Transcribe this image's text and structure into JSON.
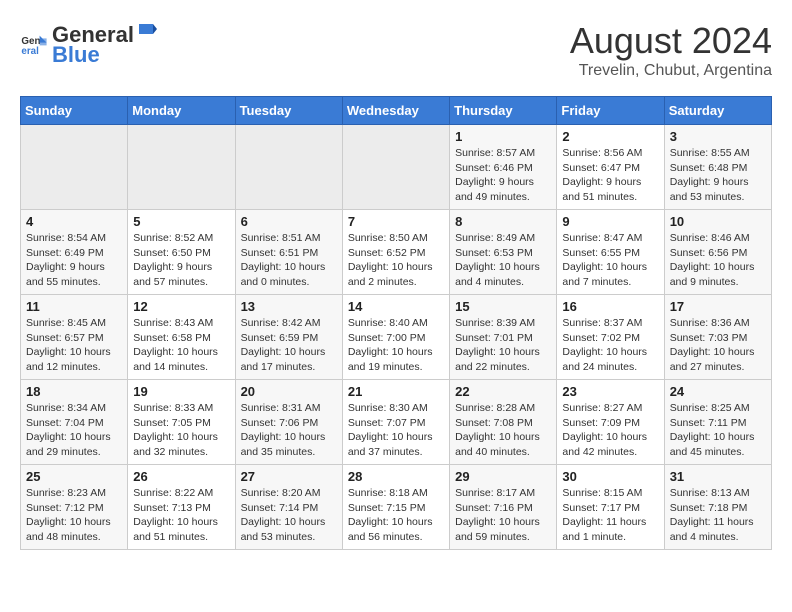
{
  "header": {
    "logo_general": "General",
    "logo_blue": "Blue",
    "month_year": "August 2024",
    "location": "Trevelin, Chubut, Argentina"
  },
  "days_of_week": [
    "Sunday",
    "Monday",
    "Tuesday",
    "Wednesday",
    "Thursday",
    "Friday",
    "Saturday"
  ],
  "weeks": [
    [
      {
        "day": "",
        "info": ""
      },
      {
        "day": "",
        "info": ""
      },
      {
        "day": "",
        "info": ""
      },
      {
        "day": "",
        "info": ""
      },
      {
        "day": "1",
        "info": "Sunrise: 8:57 AM\nSunset: 6:46 PM\nDaylight: 9 hours\nand 49 minutes."
      },
      {
        "day": "2",
        "info": "Sunrise: 8:56 AM\nSunset: 6:47 PM\nDaylight: 9 hours\nand 51 minutes."
      },
      {
        "day": "3",
        "info": "Sunrise: 8:55 AM\nSunset: 6:48 PM\nDaylight: 9 hours\nand 53 minutes."
      }
    ],
    [
      {
        "day": "4",
        "info": "Sunrise: 8:54 AM\nSunset: 6:49 PM\nDaylight: 9 hours\nand 55 minutes."
      },
      {
        "day": "5",
        "info": "Sunrise: 8:52 AM\nSunset: 6:50 PM\nDaylight: 9 hours\nand 57 minutes."
      },
      {
        "day": "6",
        "info": "Sunrise: 8:51 AM\nSunset: 6:51 PM\nDaylight: 10 hours\nand 0 minutes."
      },
      {
        "day": "7",
        "info": "Sunrise: 8:50 AM\nSunset: 6:52 PM\nDaylight: 10 hours\nand 2 minutes."
      },
      {
        "day": "8",
        "info": "Sunrise: 8:49 AM\nSunset: 6:53 PM\nDaylight: 10 hours\nand 4 minutes."
      },
      {
        "day": "9",
        "info": "Sunrise: 8:47 AM\nSunset: 6:55 PM\nDaylight: 10 hours\nand 7 minutes."
      },
      {
        "day": "10",
        "info": "Sunrise: 8:46 AM\nSunset: 6:56 PM\nDaylight: 10 hours\nand 9 minutes."
      }
    ],
    [
      {
        "day": "11",
        "info": "Sunrise: 8:45 AM\nSunset: 6:57 PM\nDaylight: 10 hours\nand 12 minutes."
      },
      {
        "day": "12",
        "info": "Sunrise: 8:43 AM\nSunset: 6:58 PM\nDaylight: 10 hours\nand 14 minutes."
      },
      {
        "day": "13",
        "info": "Sunrise: 8:42 AM\nSunset: 6:59 PM\nDaylight: 10 hours\nand 17 minutes."
      },
      {
        "day": "14",
        "info": "Sunrise: 8:40 AM\nSunset: 7:00 PM\nDaylight: 10 hours\nand 19 minutes."
      },
      {
        "day": "15",
        "info": "Sunrise: 8:39 AM\nSunset: 7:01 PM\nDaylight: 10 hours\nand 22 minutes."
      },
      {
        "day": "16",
        "info": "Sunrise: 8:37 AM\nSunset: 7:02 PM\nDaylight: 10 hours\nand 24 minutes."
      },
      {
        "day": "17",
        "info": "Sunrise: 8:36 AM\nSunset: 7:03 PM\nDaylight: 10 hours\nand 27 minutes."
      }
    ],
    [
      {
        "day": "18",
        "info": "Sunrise: 8:34 AM\nSunset: 7:04 PM\nDaylight: 10 hours\nand 29 minutes."
      },
      {
        "day": "19",
        "info": "Sunrise: 8:33 AM\nSunset: 7:05 PM\nDaylight: 10 hours\nand 32 minutes."
      },
      {
        "day": "20",
        "info": "Sunrise: 8:31 AM\nSunset: 7:06 PM\nDaylight: 10 hours\nand 35 minutes."
      },
      {
        "day": "21",
        "info": "Sunrise: 8:30 AM\nSunset: 7:07 PM\nDaylight: 10 hours\nand 37 minutes."
      },
      {
        "day": "22",
        "info": "Sunrise: 8:28 AM\nSunset: 7:08 PM\nDaylight: 10 hours\nand 40 minutes."
      },
      {
        "day": "23",
        "info": "Sunrise: 8:27 AM\nSunset: 7:09 PM\nDaylight: 10 hours\nand 42 minutes."
      },
      {
        "day": "24",
        "info": "Sunrise: 8:25 AM\nSunset: 7:11 PM\nDaylight: 10 hours\nand 45 minutes."
      }
    ],
    [
      {
        "day": "25",
        "info": "Sunrise: 8:23 AM\nSunset: 7:12 PM\nDaylight: 10 hours\nand 48 minutes."
      },
      {
        "day": "26",
        "info": "Sunrise: 8:22 AM\nSunset: 7:13 PM\nDaylight: 10 hours\nand 51 minutes."
      },
      {
        "day": "27",
        "info": "Sunrise: 8:20 AM\nSunset: 7:14 PM\nDaylight: 10 hours\nand 53 minutes."
      },
      {
        "day": "28",
        "info": "Sunrise: 8:18 AM\nSunset: 7:15 PM\nDaylight: 10 hours\nand 56 minutes."
      },
      {
        "day": "29",
        "info": "Sunrise: 8:17 AM\nSunset: 7:16 PM\nDaylight: 10 hours\nand 59 minutes."
      },
      {
        "day": "30",
        "info": "Sunrise: 8:15 AM\nSunset: 7:17 PM\nDaylight: 11 hours\nand 1 minute."
      },
      {
        "day": "31",
        "info": "Sunrise: 8:13 AM\nSunset: 7:18 PM\nDaylight: 11 hours\nand 4 minutes."
      }
    ]
  ]
}
